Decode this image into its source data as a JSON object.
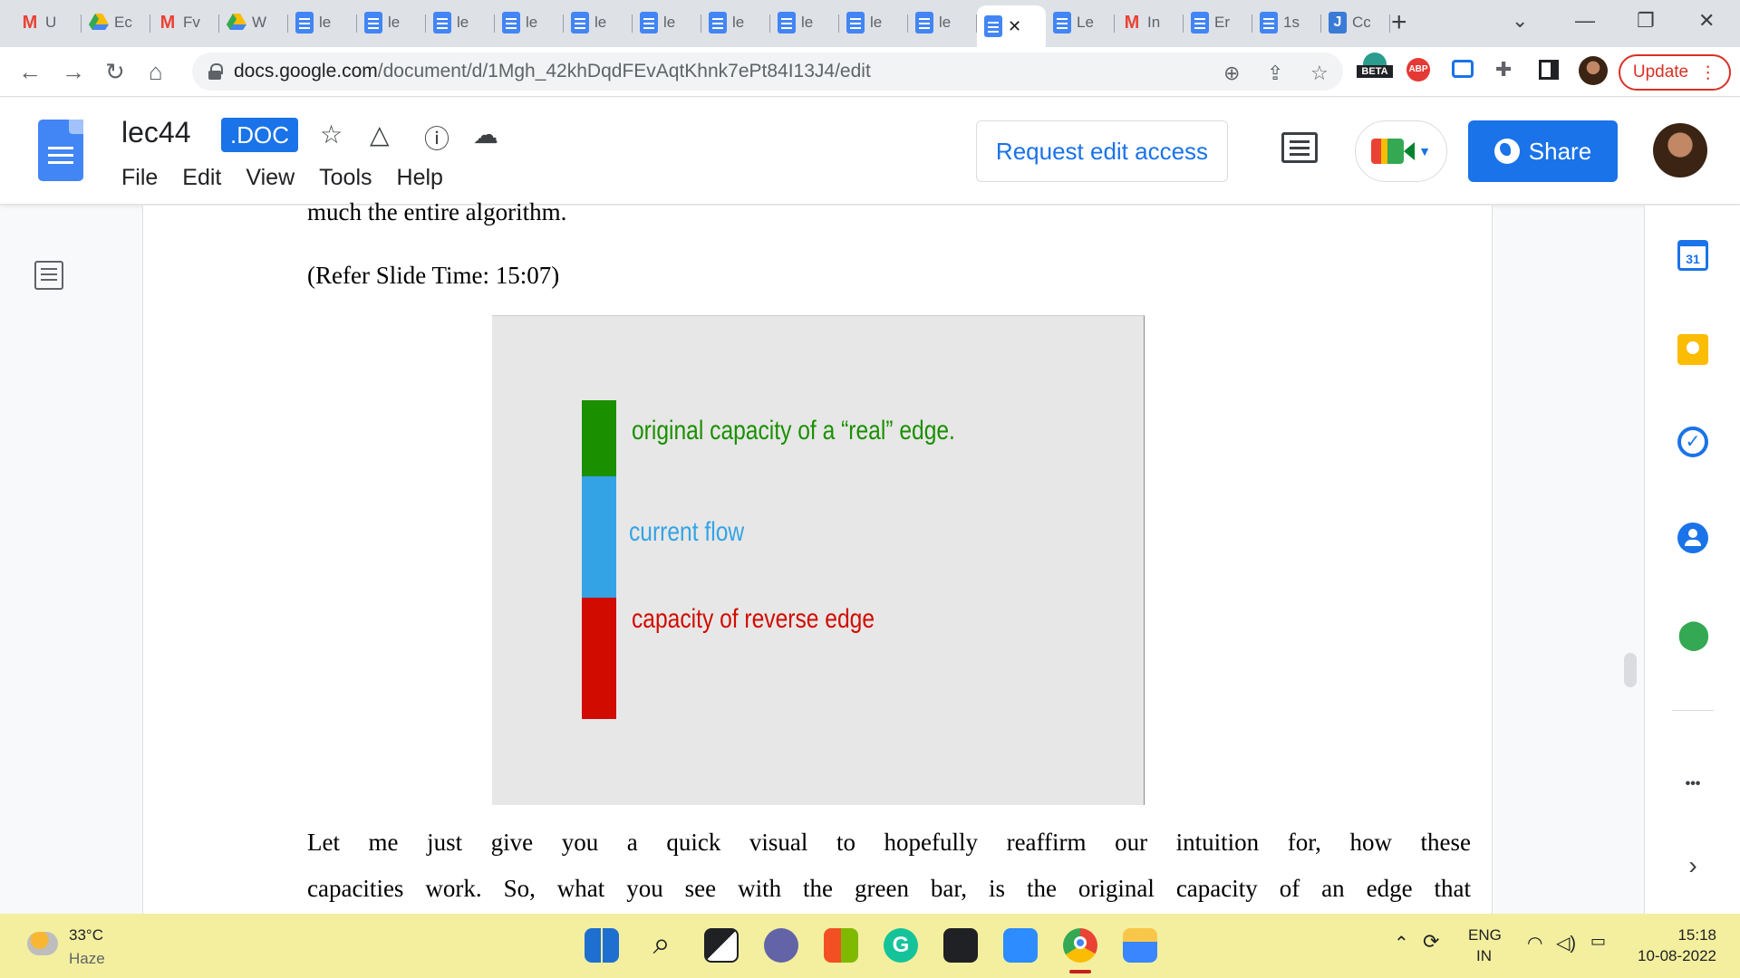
{
  "browser": {
    "tabs": [
      {
        "icon": "gmail-icon",
        "label": "U"
      },
      {
        "icon": "drive-icon",
        "label": "Ec"
      },
      {
        "icon": "gmail-icon",
        "label": "Fv"
      },
      {
        "icon": "drive-icon",
        "label": "W"
      },
      {
        "icon": "docs-icon",
        "label": "le"
      },
      {
        "icon": "docs-icon",
        "label": "le"
      },
      {
        "icon": "docs-icon",
        "label": "le"
      },
      {
        "icon": "docs-icon",
        "label": "le"
      },
      {
        "icon": "docs-icon",
        "label": "le"
      },
      {
        "icon": "docs-icon",
        "label": "le"
      },
      {
        "icon": "docs-icon",
        "label": "le"
      },
      {
        "icon": "docs-icon",
        "label": "le"
      },
      {
        "icon": "docs-icon",
        "label": "le"
      },
      {
        "icon": "docs-icon",
        "label": "le"
      },
      {
        "icon": "docs-icon",
        "label": "",
        "active": true
      },
      {
        "icon": "docs-icon",
        "label": "Le"
      },
      {
        "icon": "gmail-icon",
        "label": "In"
      },
      {
        "icon": "docs-icon",
        "label": "Er"
      },
      {
        "icon": "docs-icon",
        "label": "1s"
      },
      {
        "icon": "j-icon",
        "label": "Cc"
      }
    ],
    "url_domain": "docs.google.com",
    "url_path": "/document/d/1Mgh_42khDqdFEvAqtKhnk7ePt84I13J4/edit",
    "beta_badge": "BETA",
    "abp_badge": "ABP",
    "update_label": "Update"
  },
  "docs": {
    "title": "lec44",
    "format_badge": ".DOC",
    "menu": [
      "File",
      "Edit",
      "View",
      "Tools",
      "Help"
    ],
    "request_access_label": "Request edit access",
    "share_label": "Share"
  },
  "content": {
    "line_top": "much the entire algorithm.",
    "refer": "(Refer Slide Time: 15:07)",
    "slide": {
      "labels": {
        "green": "original capacity of a “real” edge.",
        "blue": "current flow",
        "red": "capacity of reverse edge"
      },
      "colors": {
        "green": "#1a8f00",
        "blue": "#33a3e6",
        "red": "#d10b00"
      }
    },
    "para_line1": "Let me just give you a quick visual to hopefully reaffirm our intuition for, how these",
    "para_line2": "capacities work. So, what you see with the green bar, is the original capacity of an edge that"
  },
  "sidepanel": {
    "calendar_day": "31",
    "more": "•••"
  },
  "taskbar": {
    "temp": "33°C",
    "weather": "Haze",
    "lang1": "ENG",
    "lang2": "IN",
    "time": "15:18",
    "date": "10-08-2022"
  }
}
